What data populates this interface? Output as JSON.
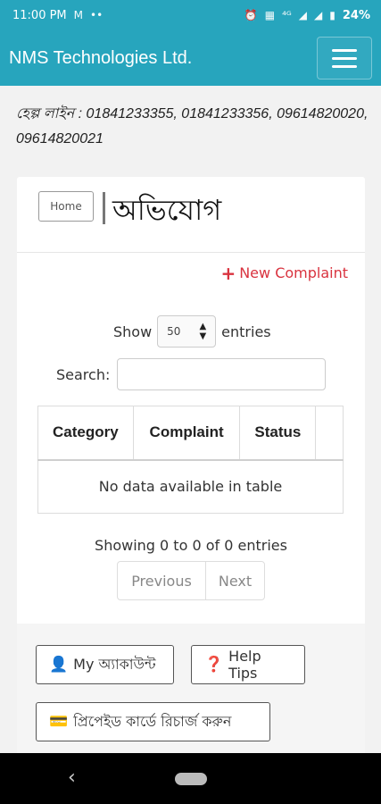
{
  "status_bar": {
    "time": "11:00 PM",
    "left_icons": [
      "gmail-icon",
      "more-dots-icon"
    ],
    "right_icons": [
      "alarm-icon",
      "hd-icon",
      "4g-icon",
      "signal-icon",
      "signal-icon",
      "battery-icon"
    ],
    "battery": "24%"
  },
  "app_bar": {
    "title": "NMS Technologies Ltd.",
    "color": "#27a5bd"
  },
  "helpline": {
    "text": "হেল্প লাইন : 01841233355, 01841233356, 09614820020, 09614820021"
  },
  "card": {
    "home_label": "Home",
    "title": "অভিযোগ",
    "new_complaint": "New Complaint",
    "show_label": "Show",
    "entries_value": "50",
    "entries_label": "entries",
    "search_label": "Search:",
    "search_value": "",
    "table": {
      "columns": [
        "Category",
        "Complaint",
        "Status",
        ""
      ],
      "empty_text": "No data available in table"
    },
    "info_text": "Showing 0 to 0 of 0 entries",
    "pager": {
      "previous": "Previous",
      "next": "Next"
    }
  },
  "footer_buttons": {
    "account": "My অ্যাকাউন্ট",
    "help": "Help Tips",
    "recharge": "প্রিপেইড কার্ডে রিচার্জ করুন"
  },
  "accent_colors": {
    "new_complaint": "#d9333f"
  }
}
